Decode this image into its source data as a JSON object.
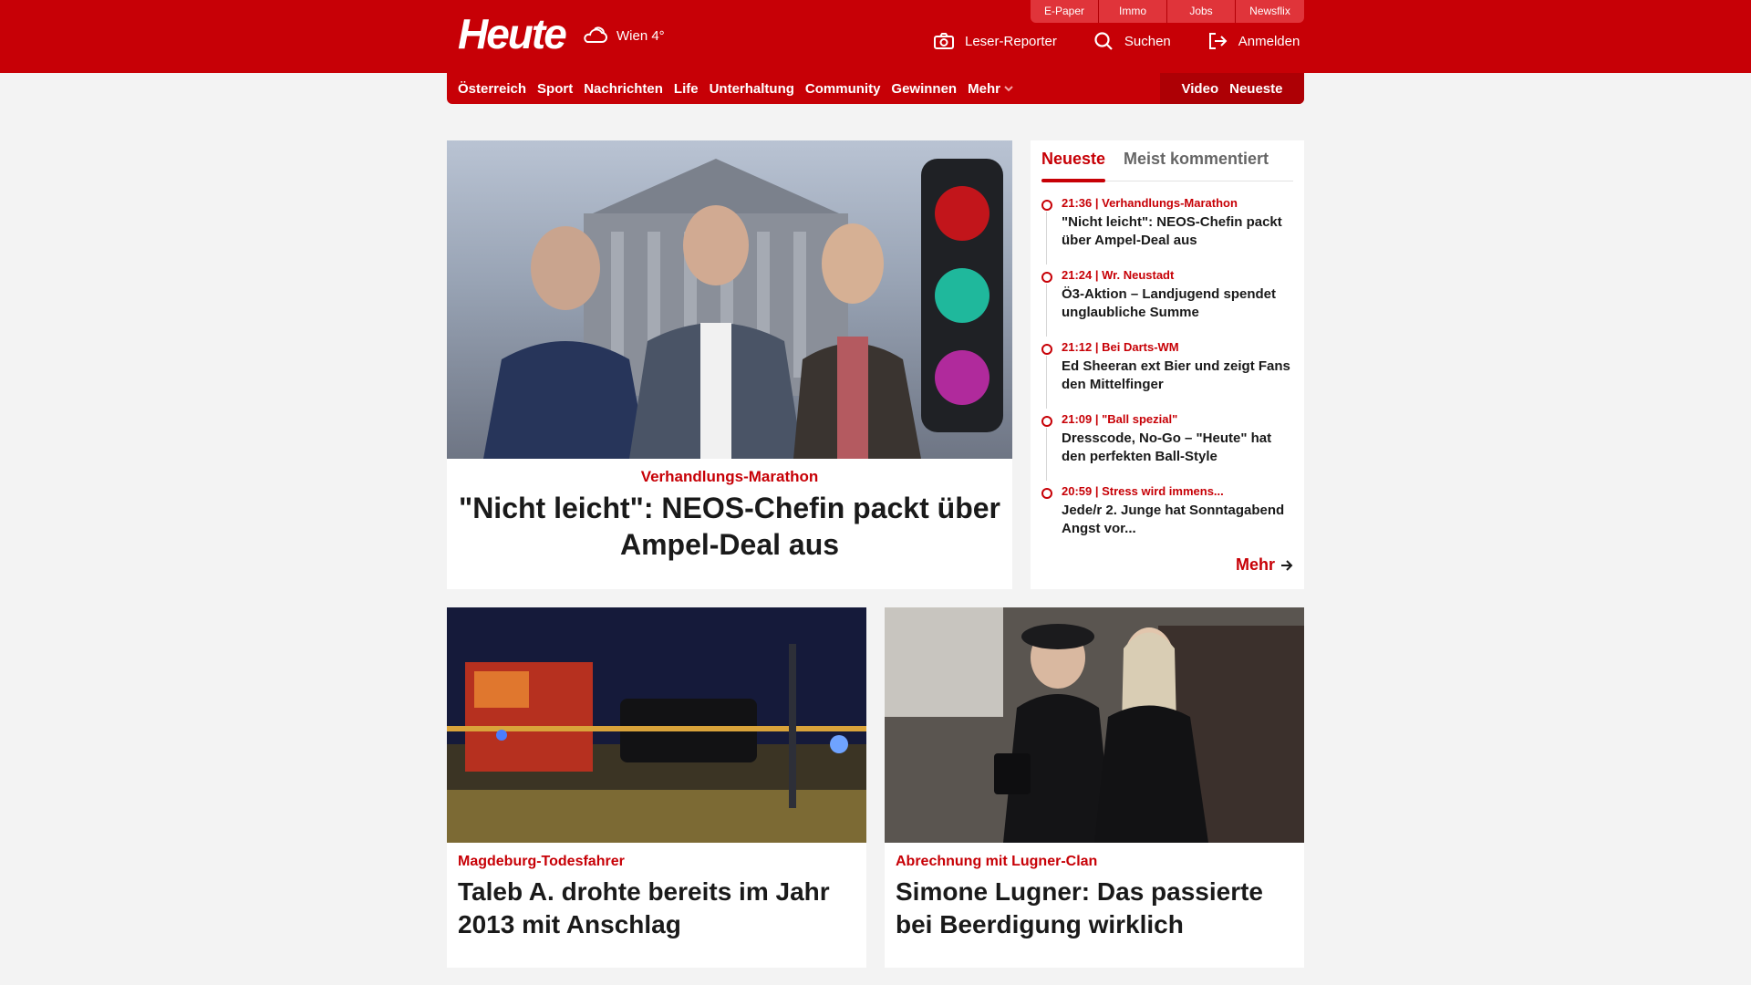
{
  "top_links": [
    "E-Paper",
    "Immo",
    "Jobs",
    "Newsflix"
  ],
  "header": {
    "logo_text": "Heute",
    "weather_text": "Wien 4°",
    "actions": {
      "reporter": "Leser-Reporter",
      "search": "Suchen",
      "login": "Anmelden"
    }
  },
  "nav": {
    "items": [
      "Österreich",
      "Sport",
      "Nachrichten",
      "Life",
      "Unterhaltung",
      "Community",
      "Gewinnen"
    ],
    "more": "Mehr",
    "right": [
      "Video",
      "Neueste"
    ]
  },
  "hero": {
    "kicker": "Verhandlungs-Marathon",
    "title": "\"Nicht leicht\": NEOS-Chefin packt über Ampel-Deal aus"
  },
  "sidebar": {
    "tabs": [
      "Neueste",
      "Meist kommentiert"
    ],
    "items": [
      {
        "meta": "21:36 | Verhandlungs-Marathon",
        "title": "\"Nicht leicht\": NEOS-Chefin packt über Ampel-Deal aus"
      },
      {
        "meta": "21:24 | Wr. Neustadt",
        "title": "Ö3-Aktion – Landjugend spendet unglaubliche Summe"
      },
      {
        "meta": "21:12 | Bei Darts-WM",
        "title": "Ed Sheeran ext Bier und zeigt Fans den Mittelfinger"
      },
      {
        "meta": "21:09 | \"Ball spezial\"",
        "title": "Dresscode, No-Go – \"Heute\" hat den perfekten Ball-Style"
      },
      {
        "meta": "20:59 | Stress wird immens...",
        "title": "Jede/r 2. Junge hat Sonntagabend Angst vor..."
      }
    ],
    "more": "Mehr"
  },
  "cards": [
    {
      "kicker": "Magdeburg-Todesfahrer",
      "title": "Taleb A. drohte bereits im Jahr 2013 mit Anschlag"
    },
    {
      "kicker": "Abrechnung mit Lugner-Clan",
      "title": "Simone Lugner: Das passierte bei Beerdigung wirklich"
    }
  ],
  "colors": {
    "brand_red": "#c70006",
    "page_bg": "#f3f3f3"
  },
  "icons": {
    "weather": "cloud-sun-icon",
    "reporter": "camera-icon",
    "search": "search-icon",
    "login": "login-icon",
    "more_nav": "chevron-down-icon",
    "more_link": "arrow-right-icon"
  }
}
